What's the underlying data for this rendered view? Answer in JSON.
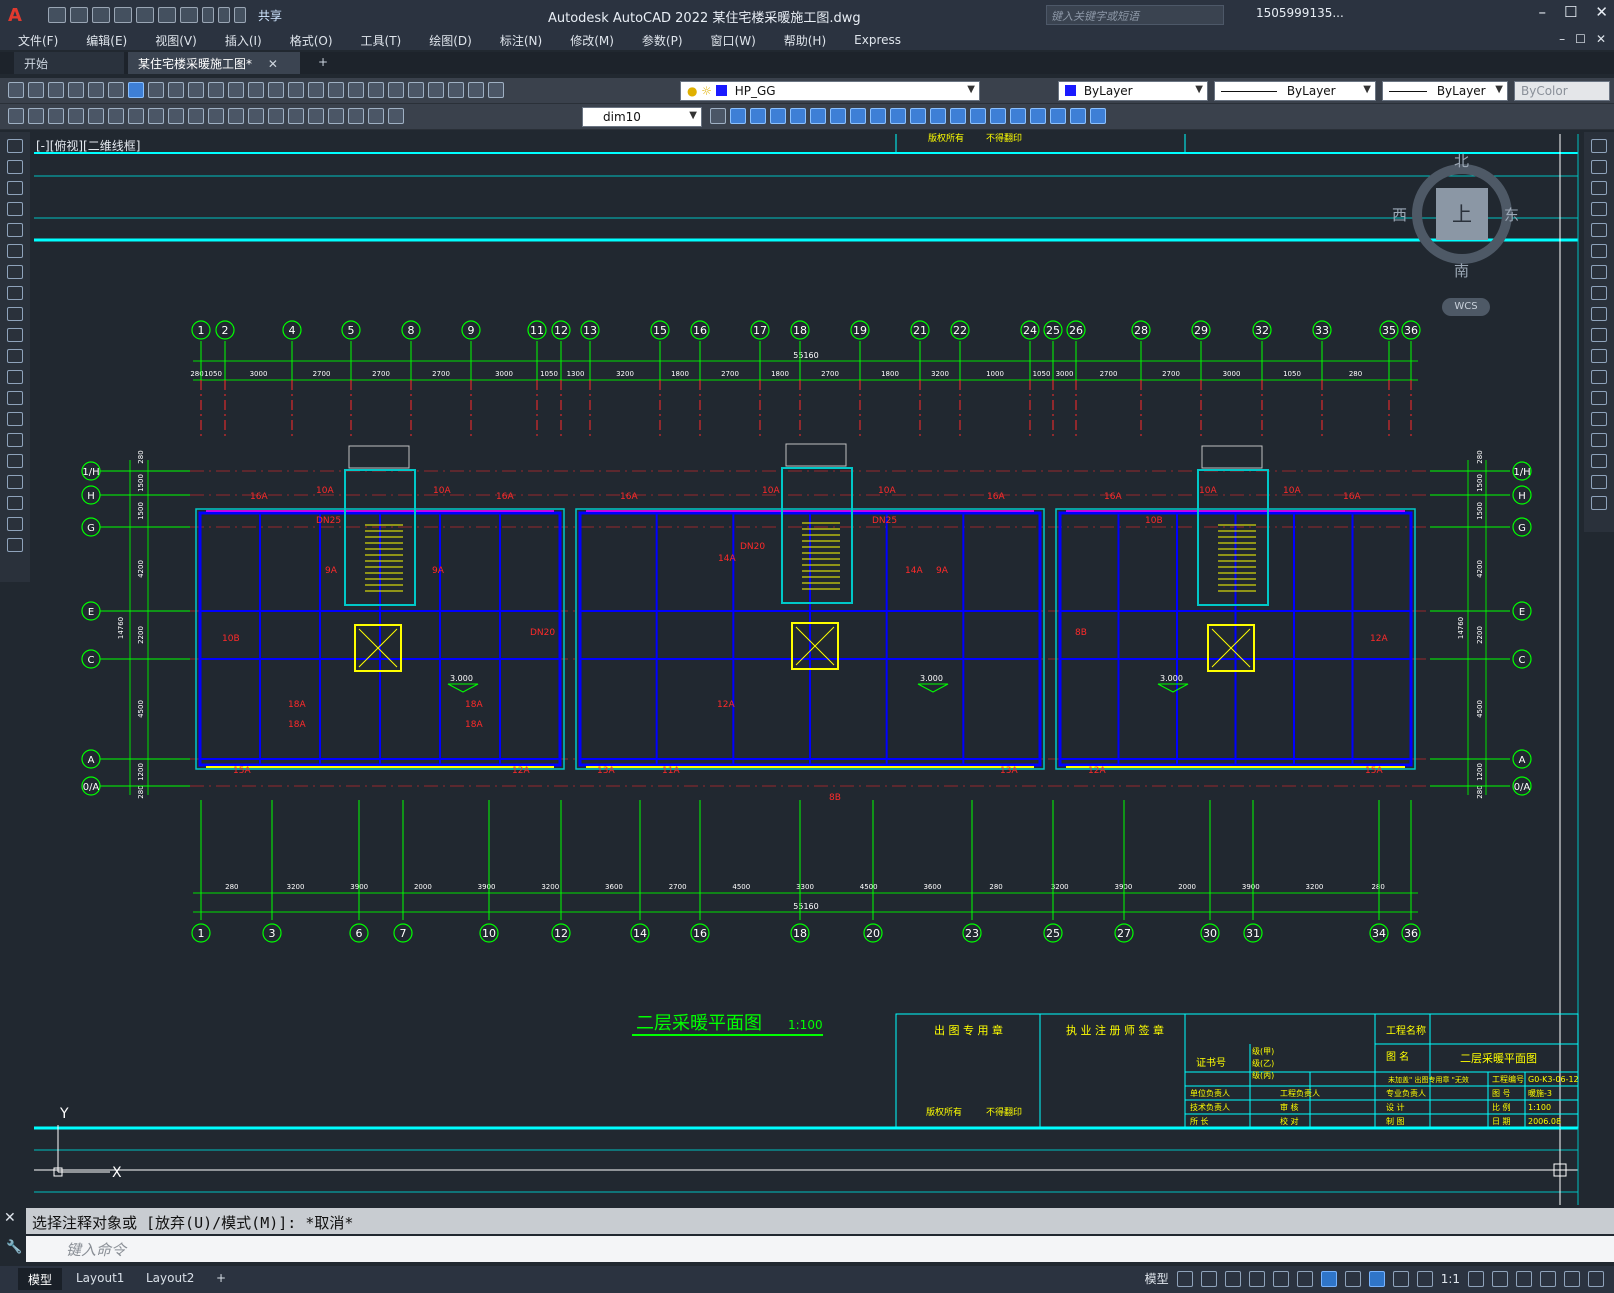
{
  "app": {
    "title": "Autodesk AutoCAD 2022    某住宅楼采暖施工图.dwg",
    "logo": "A",
    "share_label": "共享",
    "search_placeholder": "键入关键字或短语",
    "user": "1505999135...",
    "window_controls": [
      "–",
      "☐",
      "✕"
    ]
  },
  "menu": {
    "items": [
      "文件(F)",
      "编辑(E)",
      "视图(V)",
      "插入(I)",
      "格式(O)",
      "工具(T)",
      "绘图(D)",
      "标注(N)",
      "修改(M)",
      "参数(P)",
      "窗口(W)",
      "帮助(H)",
      "Express"
    ]
  },
  "tabs": {
    "start": "开始",
    "active": "某住宅楼采暖施工图*",
    "close": "✕",
    "add": "+"
  },
  "toolbar": {
    "layer": "HP_GG",
    "color": "ByLayer",
    "linetype": "ByLayer",
    "lineweight": "ByLayer",
    "plotstyle": "ByColor",
    "dimstyle": "dim10",
    "layer_color": "#1a1aff",
    "color_swatch": "#1a1aff"
  },
  "viewport": {
    "label": "[-][俯视][二维线框]"
  },
  "viewcube": {
    "north": "北",
    "south": "南",
    "east": "东",
    "west": "西",
    "face": "上",
    "wcs": "WCS"
  },
  "drawing": {
    "title": "二层采暖平面图",
    "scale": "1:100",
    "top_axes": [
      "1",
      "2",
      "4",
      "5",
      "8",
      "9",
      "11",
      "12",
      "13",
      "15",
      "16",
      "17",
      "18",
      "19",
      "21",
      "22",
      "24",
      "25",
      "26",
      "28",
      "29",
      "32",
      "33",
      "35",
      "36"
    ],
    "bottom_axes": [
      "1",
      "3",
      "6",
      "7",
      "10",
      "12",
      "14",
      "16",
      "18",
      "20",
      "23",
      "25",
      "27",
      "30",
      "31",
      "34",
      "36"
    ],
    "left_axes": [
      "1/H",
      "H",
      "G",
      "E",
      "C",
      "A",
      "0/A"
    ],
    "top_dims": [
      "280",
      "1050",
      "3000",
      "2700",
      "2700",
      "2700",
      "3000",
      "1050",
      "1300",
      "3200",
      "1800",
      "2700",
      "1800",
      "2700",
      "1800",
      "3200",
      "1000",
      "1050",
      "3000",
      "2700",
      "2700",
      "3000",
      "1050",
      "280"
    ],
    "bottom_dims": [
      "280",
      "3200",
      "3900",
      "2000",
      "3900",
      "3200",
      "3600",
      "2700",
      "4500",
      "3300",
      "4500",
      "3600",
      "280",
      "3200",
      "3900",
      "2000",
      "3900",
      "3200",
      "280"
    ],
    "total_dim": "55160",
    "left_dims": [
      "280",
      "1500",
      "1500",
      "4200",
      "2200",
      "4500",
      "1200",
      "280"
    ],
    "overall_side_dim": "14760",
    "levels": [
      "3.000",
      "3.000",
      "3.000"
    ],
    "rad_tags": [
      "16A",
      "10A",
      "10A",
      "16A",
      "16A",
      "10A",
      "10A",
      "16A",
      "16A",
      "10A",
      "10A",
      "16A",
      "9A",
      "9A",
      "14A",
      "9A",
      "14A",
      "18A",
      "18A",
      "18A",
      "18A",
      "12A",
      "13A",
      "11A",
      "15A",
      "15A",
      "12A",
      "13A",
      "12A",
      "10B",
      "10B",
      "DN20",
      "DN25",
      "DN25",
      "DN20",
      "8B",
      "8B",
      "12A"
    ]
  },
  "titleblock": {
    "col1": "出 图 专 用 章",
    "col2": "执 业 注 册 师 签 章",
    "project_label": "工程名称",
    "drawing_name_label": "图  名",
    "drawing_name": "二层采暖平面图",
    "cert_label": "证书号",
    "grade_rows": [
      "级(甲)",
      "级(乙)",
      "级(丙)"
    ],
    "role_rows": [
      "单位负责人",
      "技术负责人",
      "所  长"
    ],
    "role_rows2": [
      "工程负责人",
      "审  核",
      "校  对"
    ],
    "role_rows3": [
      "专业负责人",
      "设  计",
      "制  图"
    ],
    "info_labels": [
      "工程编号",
      "图  号",
      "比  例",
      "日  期"
    ],
    "info_values": [
      "G0-K3-06-12",
      "暖施-3",
      "1:100",
      "2006.08"
    ],
    "owner": "版权所有",
    "no_copy": "不得翻印",
    "spec_note": "未加盖\" 出图专用章 \"无效"
  },
  "command": {
    "history": "选择注释对象或 [放弃(U)/模式(M)]: *取消*",
    "input_placeholder": "键入命令"
  },
  "status": {
    "layouts": [
      "模型",
      "Layout1",
      "Layout2",
      "+"
    ],
    "model_label": "模型",
    "scale": "1:1"
  },
  "colors": {
    "background": "#212830",
    "axis_green": "#00ff00",
    "dim_green": "#00e000",
    "wall_blue": "#0000ff",
    "wall_cyan": "#00c8c8",
    "heating_red": "#ff2a2a",
    "magenta": "#ff00ff",
    "yellow": "#ffff00",
    "frame_cyan": "#00ffff"
  }
}
